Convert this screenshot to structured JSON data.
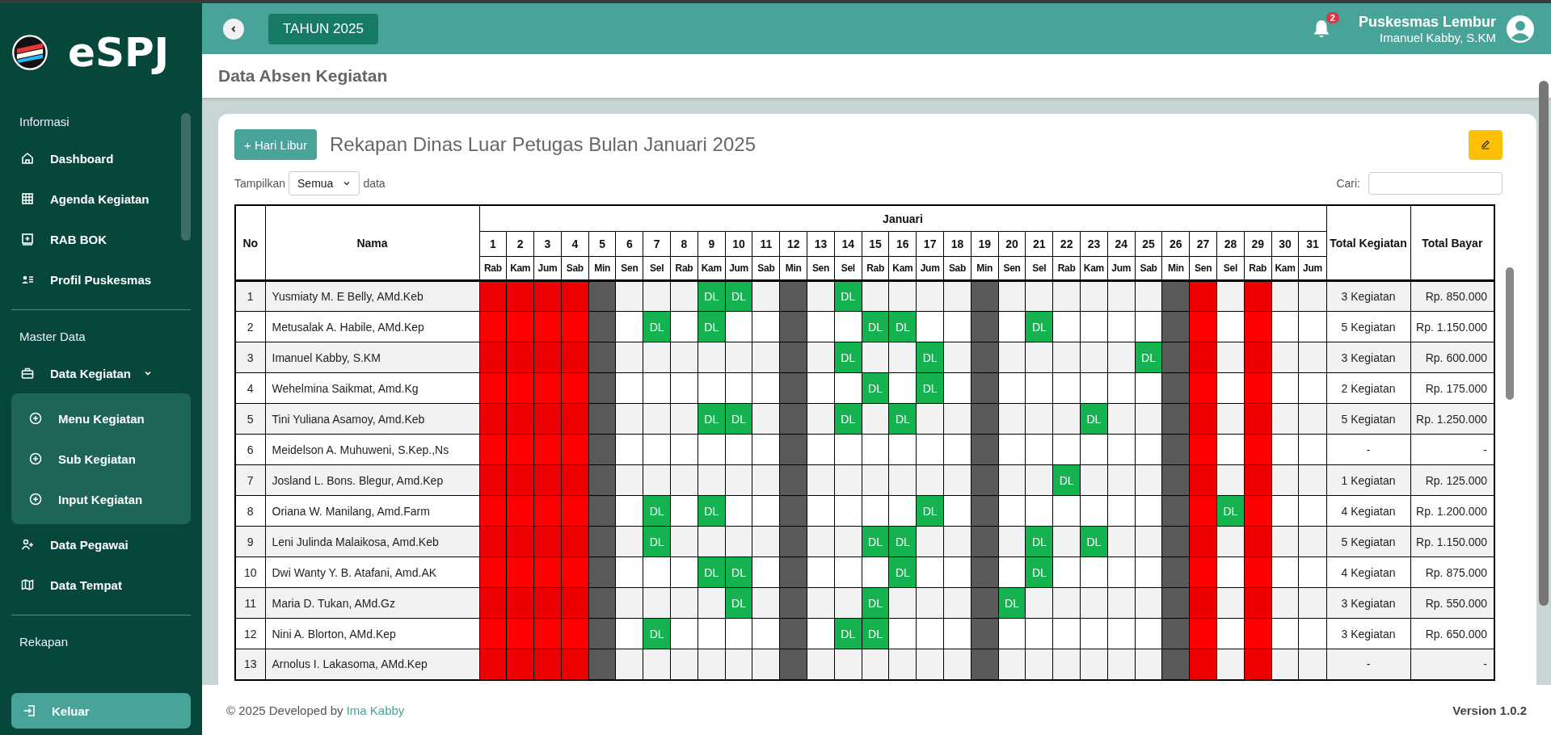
{
  "sidebar": {
    "logo": "eSPJ",
    "sections": [
      {
        "title": "Informasi",
        "items": [
          {
            "label": "Dashboard",
            "kind": "home"
          },
          {
            "label": "Agenda Kegiatan",
            "kind": "grid"
          },
          {
            "label": "RAB BOK",
            "kind": "plusbox"
          },
          {
            "label": "Profil Puskesmas",
            "kind": "idcard"
          }
        ]
      },
      {
        "title": "Master Data",
        "items": [
          {
            "label": "Data Kegiatan",
            "kind": "briefcase",
            "expanded": true,
            "children": [
              {
                "label": "Menu Kegiatan"
              },
              {
                "label": "Sub Kegiatan"
              },
              {
                "label": "Input Kegiatan"
              }
            ]
          },
          {
            "label": "Data Pegawai",
            "kind": "userplus"
          },
          {
            "label": "Data Tempat",
            "kind": "map"
          }
        ]
      },
      {
        "title": "Rekapan"
      }
    ],
    "logout": "Keluar"
  },
  "topbar": {
    "year": "TAHUN 2025",
    "notifications": "2",
    "org": "Puskesmas Lembur",
    "user": "Imanuel Kabby, S.KM"
  },
  "page_title": "Data Absen Kegiatan",
  "card": {
    "add_button": "+ Hari Libur",
    "title": "Rekapan Dinas Luar Petugas Bulan Januari 2025",
    "show_label": "Tampilkan",
    "show_value": "Semua",
    "show_suffix": "data",
    "search_label": "Cari:"
  },
  "table": {
    "col_no": "No",
    "col_name": "Nama",
    "month": "Januari",
    "col_total": "Total Kegiatan",
    "col_pay": "Total Bayar",
    "days": [
      {
        "num": "1",
        "name": "Rab",
        "kind": "holiday"
      },
      {
        "num": "2",
        "name": "Kam",
        "kind": "holiday"
      },
      {
        "num": "3",
        "name": "Jum",
        "kind": "holiday"
      },
      {
        "num": "4",
        "name": "Sab",
        "kind": "holiday"
      },
      {
        "num": "5",
        "name": "Min",
        "kind": "sunday"
      },
      {
        "num": "6",
        "name": "Sen",
        "kind": "work"
      },
      {
        "num": "7",
        "name": "Sel",
        "kind": "work"
      },
      {
        "num": "8",
        "name": "Rab",
        "kind": "work"
      },
      {
        "num": "9",
        "name": "Kam",
        "kind": "work"
      },
      {
        "num": "10",
        "name": "Jum",
        "kind": "work"
      },
      {
        "num": "11",
        "name": "Sab",
        "kind": "work"
      },
      {
        "num": "12",
        "name": "Min",
        "kind": "sunday"
      },
      {
        "num": "13",
        "name": "Sen",
        "kind": "work"
      },
      {
        "num": "14",
        "name": "Sel",
        "kind": "work"
      },
      {
        "num": "15",
        "name": "Rab",
        "kind": "work"
      },
      {
        "num": "16",
        "name": "Kam",
        "kind": "work"
      },
      {
        "num": "17",
        "name": "Jum",
        "kind": "work"
      },
      {
        "num": "18",
        "name": "Sab",
        "kind": "work"
      },
      {
        "num": "19",
        "name": "Min",
        "kind": "sunday"
      },
      {
        "num": "20",
        "name": "Sen",
        "kind": "work"
      },
      {
        "num": "21",
        "name": "Sel",
        "kind": "work"
      },
      {
        "num": "22",
        "name": "Rab",
        "kind": "work"
      },
      {
        "num": "23",
        "name": "Kam",
        "kind": "work"
      },
      {
        "num": "24",
        "name": "Jum",
        "kind": "work"
      },
      {
        "num": "25",
        "name": "Sab",
        "kind": "work"
      },
      {
        "num": "26",
        "name": "Min",
        "kind": "sunday"
      },
      {
        "num": "27",
        "name": "Sen",
        "kind": "holiday"
      },
      {
        "num": "28",
        "name": "Sel",
        "kind": "work"
      },
      {
        "num": "29",
        "name": "Rab",
        "kind": "holiday"
      },
      {
        "num": "30",
        "name": "Kam",
        "kind": "work"
      },
      {
        "num": "31",
        "name": "Jum",
        "kind": "work"
      }
    ],
    "rows": [
      {
        "no": "1",
        "name": "Yusmiaty M. E Belly, AMd.Keb",
        "total": "3 Kegiatan",
        "pay": "Rp. 850.000",
        "cells": [
          {},
          {},
          {},
          {},
          {},
          {},
          {},
          {},
          {
            "text": "DL"
          },
          {
            "text": "DL"
          },
          {},
          {},
          {},
          {
            "text": "DL"
          },
          {},
          {},
          {},
          {},
          {},
          {},
          {},
          {},
          {},
          {},
          {},
          {},
          {},
          {},
          {},
          {},
          {}
        ]
      },
      {
        "no": "2",
        "name": "Metusalak A. Habile, AMd.Kep",
        "total": "5 Kegiatan",
        "pay": "Rp. 1.150.000",
        "cells": [
          {},
          {},
          {},
          {},
          {},
          {},
          {
            "text": "DL"
          },
          {},
          {
            "text": "DL"
          },
          {},
          {},
          {},
          {},
          {},
          {
            "text": "DL"
          },
          {
            "text": "DL"
          },
          {},
          {},
          {},
          {},
          {
            "text": "DL"
          },
          {},
          {},
          {},
          {},
          {},
          {},
          {},
          {},
          {},
          {}
        ]
      },
      {
        "no": "3",
        "name": "Imanuel Kabby, S.KM",
        "total": "3 Kegiatan",
        "pay": "Rp. 600.000",
        "cells": [
          {},
          {},
          {},
          {},
          {},
          {},
          {},
          {},
          {},
          {},
          {},
          {},
          {},
          {
            "text": "DL"
          },
          {},
          {},
          {
            "text": "DL"
          },
          {},
          {},
          {},
          {},
          {},
          {},
          {},
          {
            "text": "DL"
          },
          {},
          {},
          {},
          {},
          {},
          {}
        ]
      },
      {
        "no": "4",
        "name": "Wehelmina Saikmat, Amd.Kg",
        "total": "2 Kegiatan",
        "pay": "Rp. 175.000",
        "cells": [
          {},
          {},
          {},
          {},
          {},
          {},
          {},
          {},
          {},
          {},
          {},
          {},
          {},
          {},
          {
            "text": "DL"
          },
          {},
          {
            "text": "DL"
          },
          {},
          {},
          {},
          {},
          {},
          {},
          {},
          {},
          {},
          {},
          {},
          {},
          {},
          {}
        ]
      },
      {
        "no": "5",
        "name": "Tini Yuliana Asamoy, Amd.Keb",
        "total": "5 Kegiatan",
        "pay": "Rp. 1.250.000",
        "cells": [
          {},
          {},
          {},
          {},
          {},
          {},
          {},
          {},
          {
            "text": "DL"
          },
          {
            "text": "DL"
          },
          {},
          {},
          {},
          {
            "text": "DL"
          },
          {},
          {
            "text": "DL"
          },
          {},
          {},
          {},
          {},
          {},
          {},
          {
            "text": "DL"
          },
          {},
          {},
          {},
          {},
          {},
          {},
          {},
          {}
        ]
      },
      {
        "no": "6",
        "name": "Meidelson A. Muhuweni, S.Kep.,Ns",
        "total": "-",
        "pay": "-",
        "cells": [
          {},
          {},
          {},
          {},
          {},
          {},
          {},
          {},
          {},
          {},
          {},
          {},
          {},
          {},
          {},
          {},
          {},
          {},
          {},
          {},
          {},
          {},
          {},
          {},
          {},
          {},
          {},
          {},
          {},
          {},
          {}
        ]
      },
      {
        "no": "7",
        "name": "Josland L. Bons. Blegur, Amd.Kep",
        "total": "1 Kegiatan",
        "pay": "Rp. 125.000",
        "cells": [
          {},
          {},
          {},
          {},
          {},
          {},
          {},
          {},
          {},
          {},
          {},
          {},
          {},
          {},
          {},
          {},
          {},
          {},
          {},
          {},
          {},
          {
            "text": "DL"
          },
          {},
          {},
          {},
          {},
          {},
          {},
          {},
          {},
          {}
        ]
      },
      {
        "no": "8",
        "name": "Oriana W. Manilang, Amd.Farm",
        "total": "4 Kegiatan",
        "pay": "Rp. 1.200.000",
        "cells": [
          {},
          {},
          {},
          {},
          {},
          {},
          {
            "text": "DL"
          },
          {},
          {
            "text": "DL"
          },
          {},
          {},
          {},
          {},
          {},
          {},
          {},
          {
            "text": "DL"
          },
          {},
          {},
          {},
          {},
          {},
          {},
          {},
          {},
          {},
          {},
          {
            "text": "DL"
          },
          {},
          {},
          {}
        ]
      },
      {
        "no": "9",
        "name": "Leni Julinda Malaikosa, Amd.Keb",
        "total": "5 Kegiatan",
        "pay": "Rp. 1.150.000",
        "cells": [
          {},
          {},
          {},
          {},
          {},
          {},
          {
            "text": "DL"
          },
          {},
          {},
          {},
          {},
          {},
          {},
          {},
          {
            "text": "DL"
          },
          {
            "text": "DL"
          },
          {},
          {},
          {},
          {},
          {
            "text": "DL"
          },
          {},
          {
            "text": "DL"
          },
          {},
          {},
          {},
          {},
          {},
          {},
          {},
          {}
        ]
      },
      {
        "no": "10",
        "name": "Dwi Wanty Y. B. Atafani, Amd.AK",
        "total": "4 Kegiatan",
        "pay": "Rp. 875.000",
        "cells": [
          {},
          {},
          {},
          {},
          {},
          {},
          {},
          {},
          {
            "text": "DL"
          },
          {
            "text": "DL"
          },
          {},
          {},
          {},
          {},
          {},
          {
            "text": "DL"
          },
          {},
          {},
          {},
          {},
          {
            "text": "DL"
          },
          {},
          {},
          {},
          {},
          {},
          {},
          {},
          {},
          {},
          {}
        ]
      },
      {
        "no": "11",
        "name": "Maria D. Tukan, AMd.Gz",
        "total": "3 Kegiatan",
        "pay": "Rp. 550.000",
        "cells": [
          {},
          {},
          {},
          {},
          {},
          {},
          {},
          {},
          {},
          {
            "text": "DL"
          },
          {},
          {},
          {},
          {},
          {
            "text": "DL"
          },
          {},
          {},
          {},
          {},
          {
            "text": "DL"
          },
          {},
          {},
          {},
          {},
          {},
          {},
          {},
          {},
          {},
          {},
          {}
        ]
      },
      {
        "no": "12",
        "name": "Nini A. Blorton, AMd.Kep",
        "total": "3 Kegiatan",
        "pay": "Rp. 650.000",
        "cells": [
          {},
          {},
          {},
          {},
          {},
          {},
          {
            "text": "DL"
          },
          {},
          {},
          {},
          {},
          {},
          {},
          {
            "text": "DL"
          },
          {
            "text": "DL"
          },
          {},
          {},
          {},
          {},
          {},
          {},
          {},
          {},
          {},
          {},
          {},
          {},
          {},
          {},
          {},
          {}
        ]
      },
      {
        "no": "13",
        "name": "Arnolus I. Lakasoma, AMd.Kep",
        "total": "-",
        "pay": "-",
        "cells": [
          {},
          {},
          {},
          {},
          {},
          {},
          {},
          {},
          {},
          {},
          {},
          {},
          {},
          {},
          {},
          {},
          {},
          {},
          {},
          {},
          {},
          {},
          {},
          {},
          {},
          {},
          {},
          {},
          {},
          {},
          {}
        ]
      }
    ]
  },
  "footer": {
    "copyright": "© 2025 Developed by",
    "author": "Ima Kabby",
    "version": "Version 1.0.2"
  }
}
